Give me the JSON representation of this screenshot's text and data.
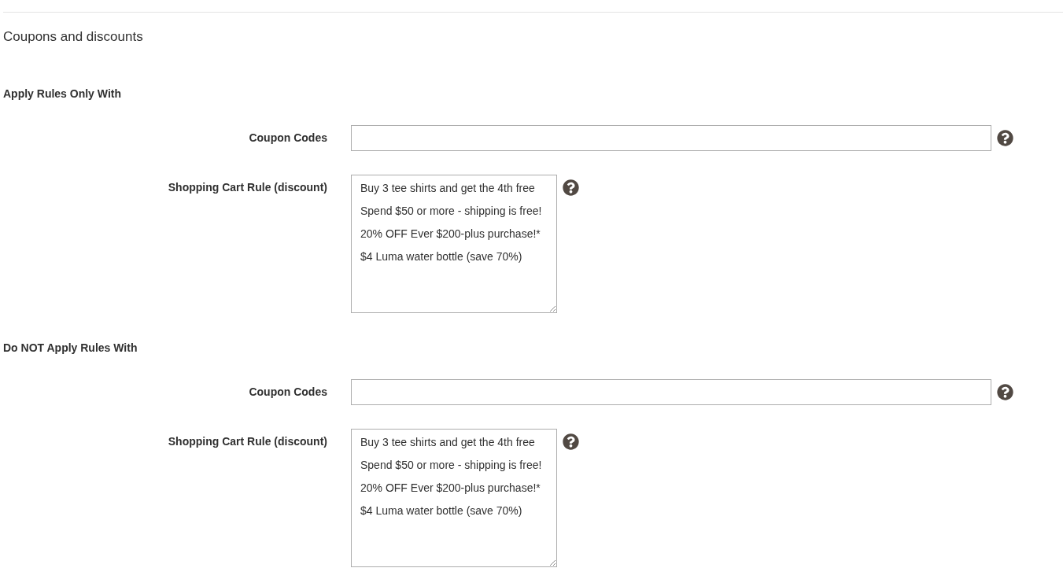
{
  "title": "Coupons and discounts",
  "sections": [
    {
      "heading": "Apply Rules Only With",
      "fields": [
        {
          "kind": "text",
          "label": "Coupon Codes"
        },
        {
          "kind": "multiselect",
          "label": "Shopping Cart Rule (discount)",
          "options": [
            {
              "label": "Buy 3 tee shirts and get the 4th free",
              "selected": false
            },
            {
              "label": "Spend $50 or more - shipping is free!",
              "selected": false
            },
            {
              "label": "20% OFF Ever $200-plus purchase!*",
              "selected": false
            },
            {
              "label": "$4 Luma water bottle (save 70%)",
              "selected": false
            }
          ]
        }
      ]
    },
    {
      "heading": "Do NOT Apply Rules With",
      "fields": [
        {
          "kind": "text",
          "label": "Coupon Codes"
        },
        {
          "kind": "multiselect",
          "label": "Shopping Cart Rule (discount)",
          "options": [
            {
              "label": "Buy 3 tee shirts and get the 4th free",
              "selected": false
            },
            {
              "label": "Spend $50 or more - shipping is free!",
              "selected": false
            },
            {
              "label": "20% OFF Ever $200-plus purchase!*",
              "selected": false
            },
            {
              "label": "$4 Luma water bottle (save 70%)",
              "selected": false
            }
          ]
        }
      ]
    }
  ]
}
